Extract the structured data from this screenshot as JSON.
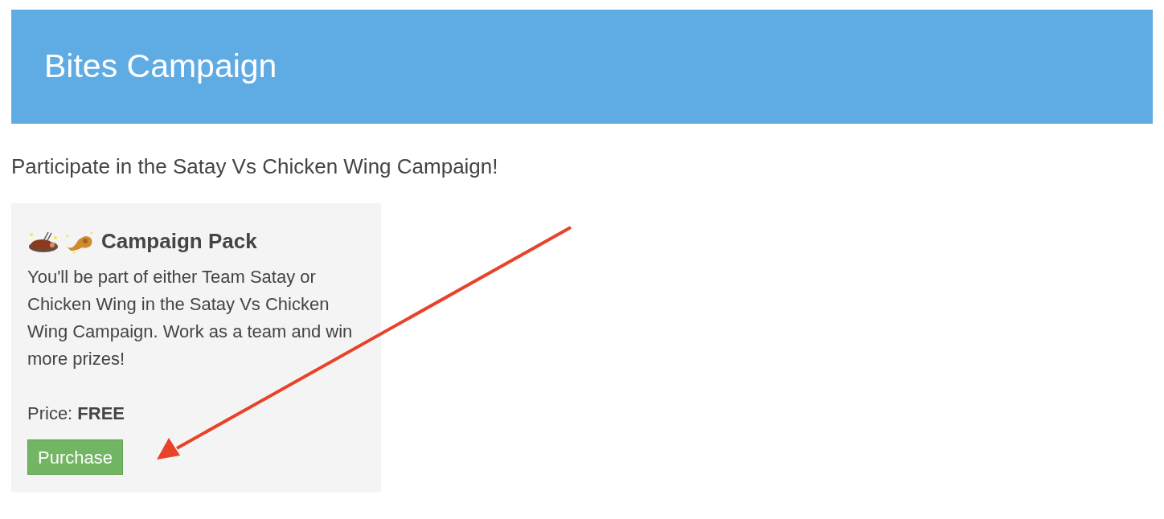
{
  "header": {
    "title": "Bites Campaign"
  },
  "intro": "Participate in the Satay Vs Chicken Wing Campaign!",
  "pack": {
    "title": "Campaign Pack",
    "description": "You'll be part of either Team Satay or Chicken Wing in the Satay Vs Chicken Wing Campaign. Work as a team and win more prizes!",
    "price": "Price: **FREE**",
    "button": "Purchase"
  }
}
